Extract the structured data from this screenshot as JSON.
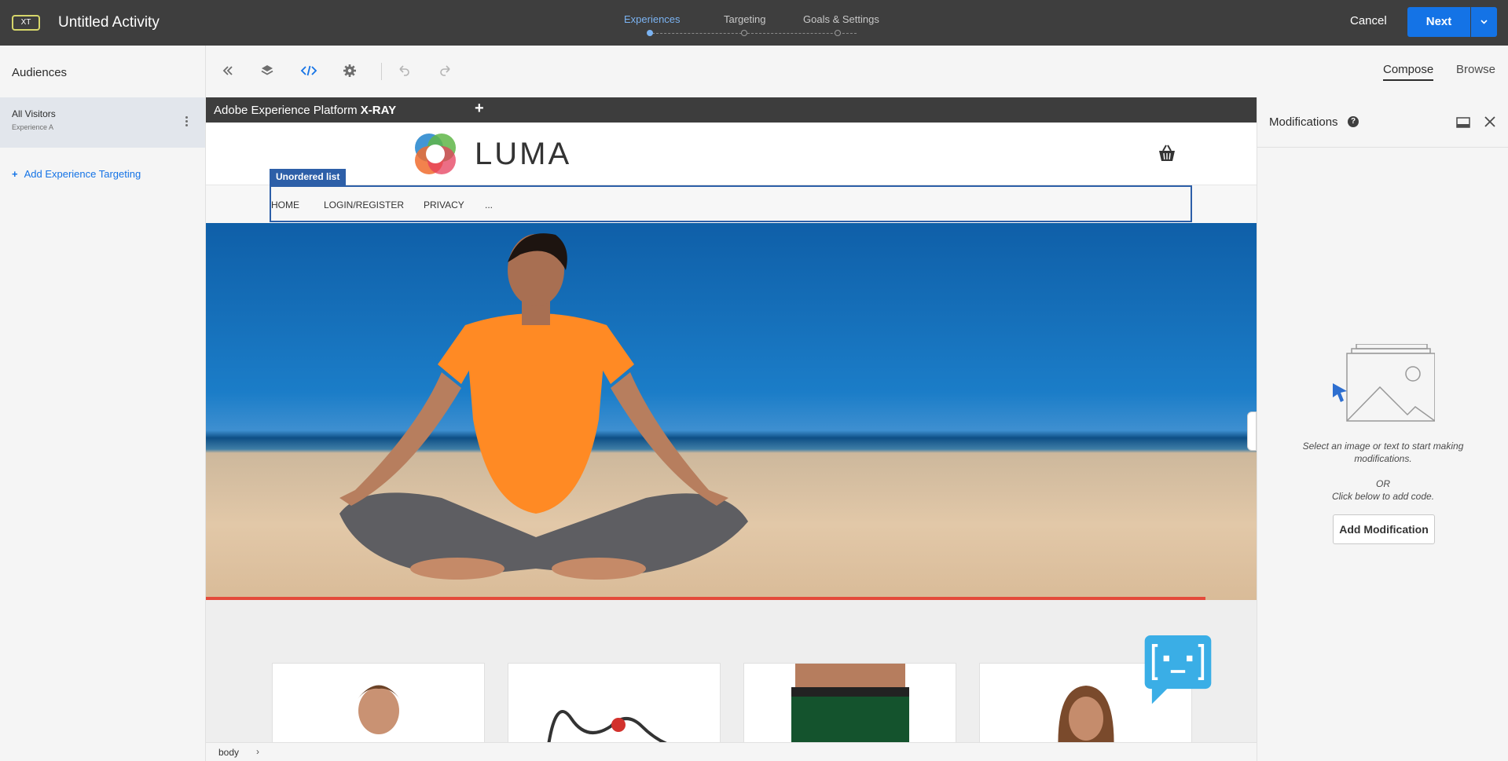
{
  "header": {
    "badge": "XT",
    "title": "Untitled Activity",
    "steps": [
      {
        "label": "Experiences",
        "active": true
      },
      {
        "label": "Targeting",
        "active": false
      },
      {
        "label": "Goals & Settings",
        "active": false
      }
    ],
    "cancel_label": "Cancel",
    "next_label": "Next"
  },
  "left_panel": {
    "title": "Audiences",
    "audience": {
      "name": "All Visitors",
      "experience": "Experience A"
    },
    "add_targeting_label": "Add Experience Targeting"
  },
  "toolbar": {
    "tools": [
      "collapse-icon",
      "layers-icon",
      "code-icon",
      "settings-icon",
      "undo-icon",
      "redo-icon"
    ],
    "compose_label": "Compose",
    "browse_label": "Browse"
  },
  "canvas": {
    "xray_title": "Adobe Experience Platform",
    "xray_bold": "X-RAY",
    "xray_plus": "+",
    "site_logo_text": "LUMA",
    "selection_label": "Unordered list",
    "nav_items": [
      "HOME",
      "LOGIN/REGISTER",
      "PRIVACY",
      "..."
    ]
  },
  "statusbar": {
    "breadcrumb": "body",
    "arrow": "›"
  },
  "right_panel": {
    "title": "Modifications",
    "help": "?",
    "empty_message": "Select an image or text to start making modifications.",
    "or_text": "OR",
    "code_hint": "Click below to add code.",
    "add_button": "Add Modification"
  },
  "colors": {
    "accent": "#1473e6",
    "header_bg": "#3e3e3e",
    "selection": "#2d5fa8",
    "step_active": "#7bb3f2"
  }
}
